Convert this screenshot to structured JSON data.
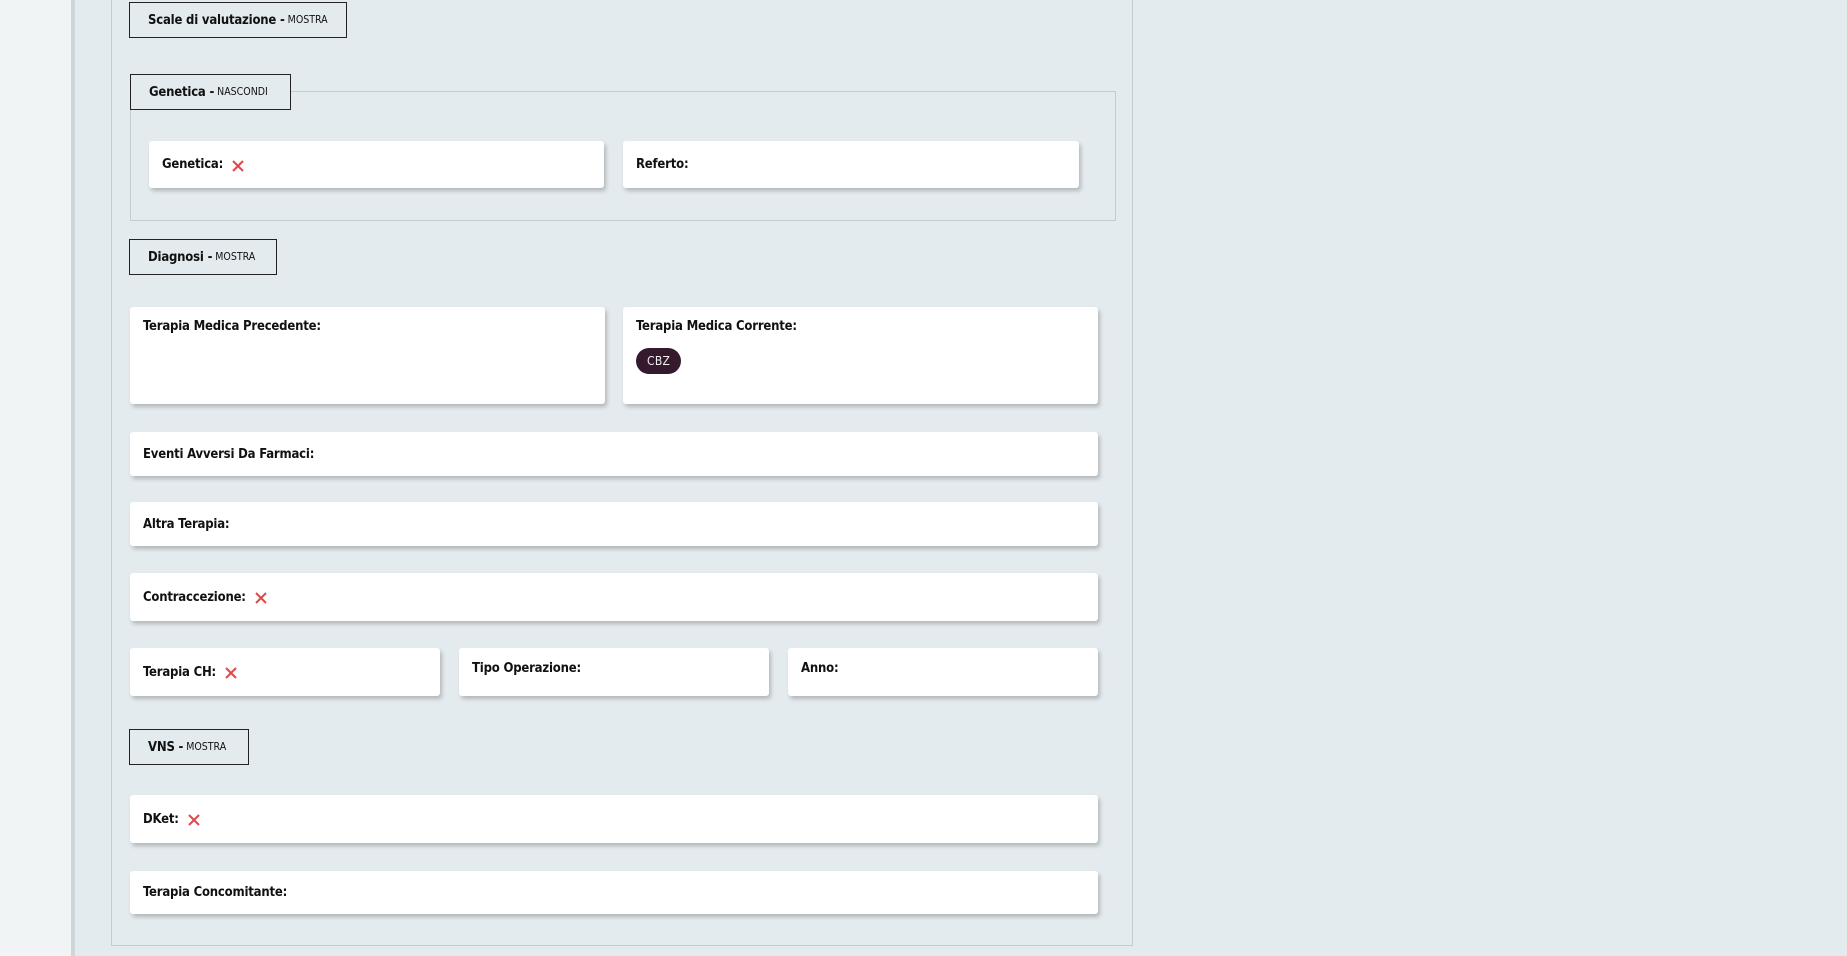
{
  "sections": {
    "scale": {
      "title": "Scale di valutazione -",
      "toggle": "MOSTRA"
    },
    "genetica": {
      "title": "Genetica -",
      "toggle": "NASCONDI"
    },
    "diagnosi": {
      "title": "Diagnosi -",
      "toggle": "MOSTRA"
    },
    "vns": {
      "title": "VNS -",
      "toggle": "MOSTRA"
    }
  },
  "fields": {
    "genetica": "Genetica:",
    "referto": "Referto:",
    "terapia_precedente": "Terapia Medica Precedente:",
    "terapia_corrente": "Terapia Medica Corrente:",
    "terapia_corrente_tag": "CBZ",
    "eventi_avversi": "Eventi Avversi Da Farmaci:",
    "altra_terapia": "Altra Terapia:",
    "contraccezione": "Contraccezione:",
    "terapia_ch": "Terapia CH:",
    "tipo_operazione": "Tipo Operazione:",
    "anno": "Anno:",
    "dket": "DKet:",
    "terapia_concomitante": "Terapia Concomitante:"
  },
  "icons": {
    "false_value": "close-x-icon"
  },
  "colors": {
    "x_icon": "#e0494a",
    "tag_bg": "#341a2c",
    "background": "#e4ebee"
  }
}
